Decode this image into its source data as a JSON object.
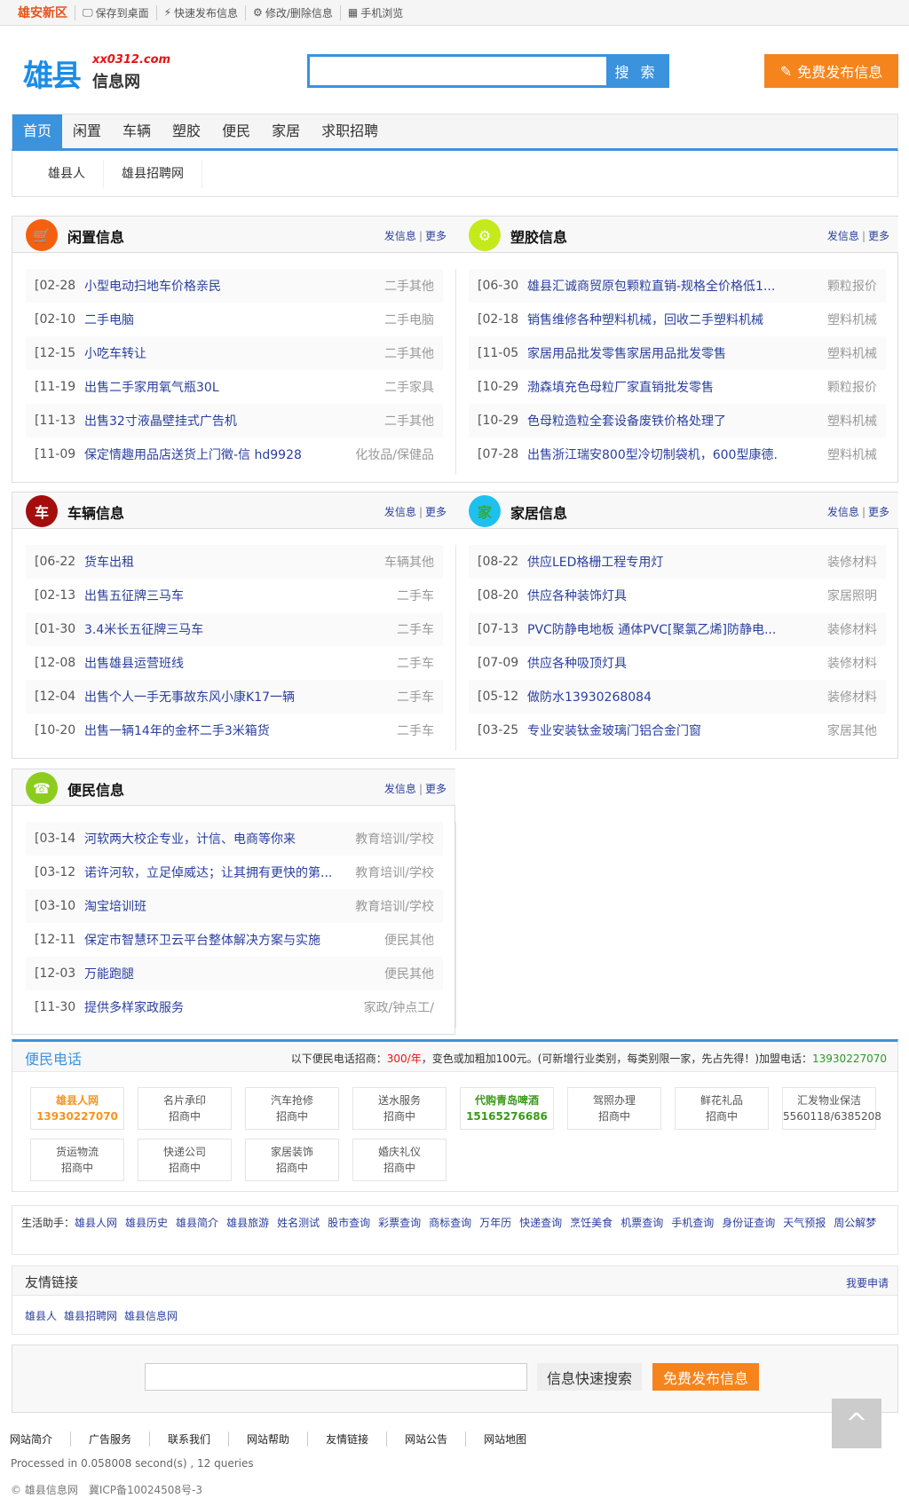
{
  "topbar": {
    "city": "雄安新区",
    "items": [
      "保存到桌面",
      "快速发布信息",
      "修改/删除信息",
      "手机浏览"
    ]
  },
  "logo": {
    "big": "雄县",
    "domain": "xx0312.com",
    "sub": "信息网"
  },
  "search": {
    "button": "搜 索",
    "value": ""
  },
  "publish_top": "免费发布信息",
  "nav": [
    "首页",
    "闲置",
    "车辆",
    "塑胶",
    "便民",
    "家居",
    "求职招聘"
  ],
  "subnav": [
    "雄县人",
    "雄县招聘网"
  ],
  "post_label": "发信息",
  "more_label": "更多",
  "panels": [
    {
      "title": "闲置信息",
      "color": "#f5600f",
      "glyph": "🛒",
      "items": [
        [
          "[02-28",
          "小型电动扫地车价格亲民",
          "二手其他"
        ],
        [
          "[02-10",
          "二手电脑",
          "二手电脑"
        ],
        [
          "[12-15",
          "小吃车转让",
          "二手其他"
        ],
        [
          "[11-19",
          "出售二手家用氧气瓶30L",
          "二手家具"
        ],
        [
          "[11-13",
          "出售32寸液晶壁挂式广告机",
          "二手其他"
        ],
        [
          "[11-09",
          "保定情趣用品店送货上门徵-信 hd9928",
          "化妆品/保健品"
        ]
      ]
    },
    {
      "title": "塑胶信息",
      "color": "#c4ea1c",
      "glyph": "⚙",
      "items": [
        [
          "[06-30",
          "雄县汇诚商贸原包颗粒直销-规格全价格低1...",
          "颗粒报价"
        ],
        [
          "[02-18",
          "销售维修各种塑料机械，回收二手塑料机械",
          "塑料机械"
        ],
        [
          "[11-05",
          "家居用品批发零售家居用品批发零售",
          "塑料机械"
        ],
        [
          "[10-29",
          "渤森填充色母粒厂家直销批发零售",
          "颗粒报价"
        ],
        [
          "[10-29",
          "色母粒造粒全套设备废铁价格处理了",
          "塑料机械"
        ],
        [
          "[07-28",
          "出售浙江瑞安800型冷切制袋机，600型康德.",
          "塑料机械"
        ]
      ]
    },
    {
      "title": "车辆信息",
      "color": "#a50d0d",
      "glyph": "车",
      "items": [
        [
          "[06-22",
          "货车出租",
          "车辆其他"
        ],
        [
          "[02-13",
          "出售五征牌三马车",
          "二手车"
        ],
        [
          "[01-30",
          "3.4米长五征牌三马车",
          "二手车"
        ],
        [
          "[12-08",
          "出售雄县运营班线",
          "二手车"
        ],
        [
          "[12-04",
          "出售个人一手无事故东风小康K17一辆",
          "二手车"
        ],
        [
          "[10-20",
          "出售一辆14年的金杯二手3米箱货",
          "二手车"
        ]
      ]
    },
    {
      "title": "家居信息",
      "color": "#1ec0f0",
      "glyph": "家",
      "items": [
        [
          "[08-22",
          "供应LED格栅工程专用灯",
          "装修材料"
        ],
        [
          "[08-20",
          "供应各种装饰灯具",
          "家居照明"
        ],
        [
          "[07-13",
          "PVC防静电地板 通体PVC[聚氯乙烯]防静电...",
          "装修材料"
        ],
        [
          "[07-09",
          "供应各种吸顶灯具",
          "装修材料"
        ],
        [
          "[05-12",
          "做防水13930268084",
          "装修材料"
        ],
        [
          "[03-25",
          "专业安装钛金玻璃门铝合金门窗",
          "家居其他"
        ]
      ]
    },
    {
      "title": "便民信息",
      "color": "#8ccc1e",
      "glyph": "☎",
      "items": [
        [
          "[03-14",
          "河软两大校企专业，计信、电商等你来",
          "教育培训/学校"
        ],
        [
          "[03-12",
          "诺许河软，立足倬威达；让其拥有更快的第...",
          "教育培训/学校"
        ],
        [
          "[03-10",
          "淘宝培训班",
          "教育培训/学校"
        ],
        [
          "[12-11",
          "保定市智慧环卫云平台整体解决方案与实施",
          "便民其他"
        ],
        [
          "[12-03",
          "万能跑腿",
          "便民其他"
        ],
        [
          "[11-30",
          "提供多样家政服务",
          "家政/钟点工/"
        ]
      ]
    }
  ],
  "tel": {
    "title": "便民电话",
    "notice_a": "以下便民电话招商：",
    "notice_price": "300/年",
    "notice_b": "，变色或加粗加100元。(可新增行业类别，每类别限一家，先占先得！)加盟电话：",
    "notice_phone": "13930227070",
    "tiles": [
      [
        "雄县人网",
        "13930227070",
        "o"
      ],
      [
        "名片承印",
        "招商中",
        ""
      ],
      [
        "汽车抢修",
        "招商中",
        ""
      ],
      [
        "送水服务",
        "招商中",
        ""
      ],
      [
        "代购青岛啤酒",
        "15165276686",
        "gr"
      ],
      [
        "驾照办理",
        "招商中",
        ""
      ],
      [
        "鲜花礼品",
        "招商中",
        ""
      ],
      [
        "汇发物业保洁",
        "5560118/6385208",
        ""
      ],
      [
        "货运物流",
        "招商中",
        ""
      ],
      [
        "快递公司",
        "招商中",
        ""
      ],
      [
        "家居装饰",
        "招商中",
        ""
      ],
      [
        "婚庆礼仪",
        "招商中",
        ""
      ]
    ]
  },
  "life": {
    "label": "生活助手：",
    "links": [
      "雄县人网",
      "雄县历史",
      "雄县简介",
      "雄县旅游",
      "姓名测试",
      "股市查询",
      "彩票查询",
      "商标查询",
      "万年历",
      "快递查询",
      "烹饪美食",
      "机票查询",
      "手机查询",
      "身份证查询",
      "天气预报",
      "周公解梦"
    ]
  },
  "friend": {
    "title": "友情链接",
    "apply": "我要申请",
    "links": [
      "雄县人",
      "雄县招聘网",
      "雄县信息网"
    ]
  },
  "bottom_search": {
    "value": "",
    "search": "信息快速搜索",
    "publish": "免费发布信息"
  },
  "footer": {
    "links": [
      "网站简介",
      "广告服务",
      "联系我们",
      "网站帮助",
      "友情链接",
      "网站公告",
      "网站地图"
    ],
    "processed": "Processed in 0.058008 second(s) , 12 queries",
    "copyright": "© 雄县信息网　冀ICP备10024508号-3"
  }
}
